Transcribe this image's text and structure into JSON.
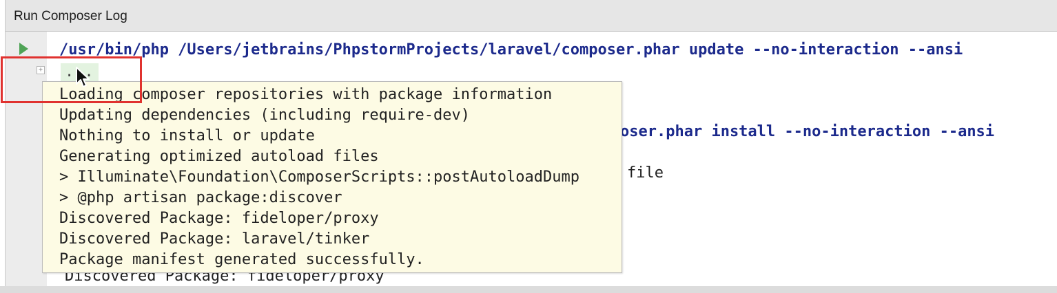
{
  "window": {
    "title": "Run Composer Log"
  },
  "console": {
    "commands": [
      "/usr/bin/php /Users/jetbrains/PhpstormProjects/laravel/composer.phar update --no-interaction --ansi",
      "oser.phar install --no-interaction --ansi"
    ],
    "folded_placeholder": "...",
    "partial_output": "file",
    "bottom_line": "Discovered Package: fideloper/proxy"
  },
  "tooltip": {
    "lines": [
      "Loading composer repositories with package information",
      "Updating dependencies (including require-dev)",
      "Nothing to install or update",
      "Generating optimized autoload files",
      "> Illuminate\\Foundation\\ComposerScripts::postAutoloadDump",
      "> @php artisan package:discover",
      "Discovered Package: fideloper/proxy",
      "Discovered Package: laravel/tinker",
      "Package manifest generated successfully."
    ]
  },
  "icons": {
    "run": "run-icon",
    "fold": "fold-expand-icon",
    "cursor": "mouse-pointer-icon"
  },
  "colors": {
    "command": "#1c2a8c",
    "tooltip_bg": "#fdfbe4",
    "highlight": "#e0322f",
    "run_icon": "#4fa356"
  }
}
